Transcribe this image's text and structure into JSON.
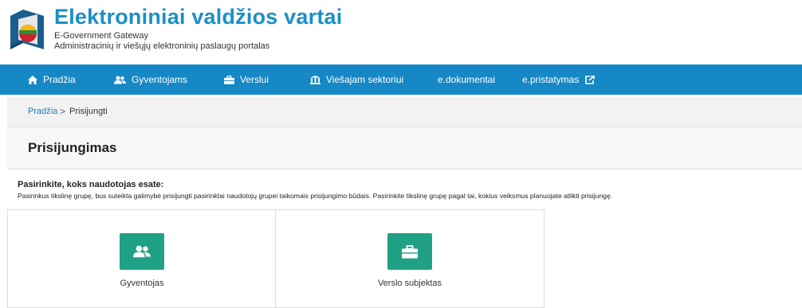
{
  "header": {
    "title": "Elektroniniai valdžios vartai",
    "subtitle_en": "E-Government Gateway",
    "subtitle_lt": "Administracinių ir viešųjų elektroninių paslaugų portalas"
  },
  "nav": {
    "items": [
      {
        "label": "Pradžia",
        "icon": "home-icon"
      },
      {
        "label": "Gyventojams",
        "icon": "users-icon"
      },
      {
        "label": "Verslui",
        "icon": "briefcase-icon"
      },
      {
        "label": "Viešajam sektoriui",
        "icon": "institution-icon"
      },
      {
        "label": "e.dokumentai",
        "icon": ""
      },
      {
        "label": "e.pristatymas",
        "icon": "external-link-icon"
      }
    ]
  },
  "breadcrumb": {
    "home": "Pradžia",
    "separator": ">",
    "current": "Prisijungti"
  },
  "page": {
    "title": "Prisijungimas",
    "instruction_heading": "Pasirinkite, koks naudotojas esate:",
    "instruction_text": "Pasirinkus tikslinę grupę, bus suteikta galimybė prisijungti pasirinktai naudotojų grupei taikomais prisijungimo būdais. Pasirinkite tikslinę grupę pagal tai, kokius veiksmus planuojate atlikti prisijungę."
  },
  "options": [
    {
      "label": "Gyventojas",
      "icon": "users-icon"
    },
    {
      "label": "Verslo subjektas",
      "icon": "briefcase-icon"
    }
  ],
  "colors": {
    "brand_blue": "#1b8fc8",
    "nav_blue": "#1688c5",
    "tile_green": "#20a186",
    "link_blue": "#1b7fb8"
  }
}
